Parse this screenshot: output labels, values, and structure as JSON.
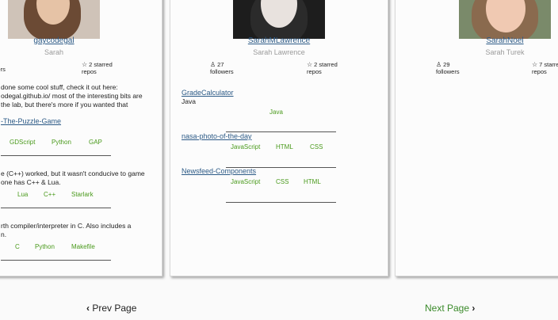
{
  "cards": [
    {
      "username": "gaycodegal",
      "fullname": "Sarah",
      "followers": "",
      "followers_label": "wers",
      "starred": "2 starred",
      "starred_label": "repos",
      "description_lines": [
        "done some cool stuff, check it out here:",
        "odegal.github.io/ most of the interesting bits are",
        "the lab, but there's more if you wanted that"
      ],
      "repos": [
        {
          "name": "-The-Puzzle-Game",
          "langs": [
            "GDScript",
            "Python",
            "GAP"
          ]
        },
        {
          "name": "",
          "desc_lines": [
            "e (C++) worked, but it wasn't conducive to game",
            "one has C++ & Lua."
          ],
          "langs": [
            "Lua",
            "C++",
            "Starlark"
          ]
        },
        {
          "name": "",
          "desc_lines": [
            "rth compiler/interpreter in C. Also includes a",
            "n."
          ],
          "langs": [
            "C",
            "Python",
            "Makefile"
          ]
        }
      ]
    },
    {
      "username": "SarahMLawrence",
      "fullname": "Sarah Lawrence",
      "followers": "27",
      "followers_label": "followers",
      "starred": "2 starred",
      "starred_label": "repos",
      "repos": [
        {
          "name": "GradeCalculator",
          "sub": "Java",
          "langs": [
            "Java"
          ]
        },
        {
          "name": "nasa-photo-of-the-day",
          "langs": [
            "JavaScript",
            "HTML",
            "CSS"
          ]
        },
        {
          "name": "Newsfeed-Components",
          "langs": [
            "JavaScript",
            "CSS",
            "HTML"
          ]
        }
      ]
    },
    {
      "username": "SarahNoel",
      "fullname": "Sarah Turek",
      "followers": "29",
      "followers_label": "followers",
      "starred": "7 starre",
      "starred_label": "repos"
    }
  ],
  "pagination": {
    "prev_label": "Prev Page",
    "next_label": "Next Page",
    "prev_icon": "‹",
    "next_icon": "›"
  },
  "colors": {
    "link": "#2c5a86",
    "language": "#4a9a1c",
    "next": "#3a8a2a"
  }
}
